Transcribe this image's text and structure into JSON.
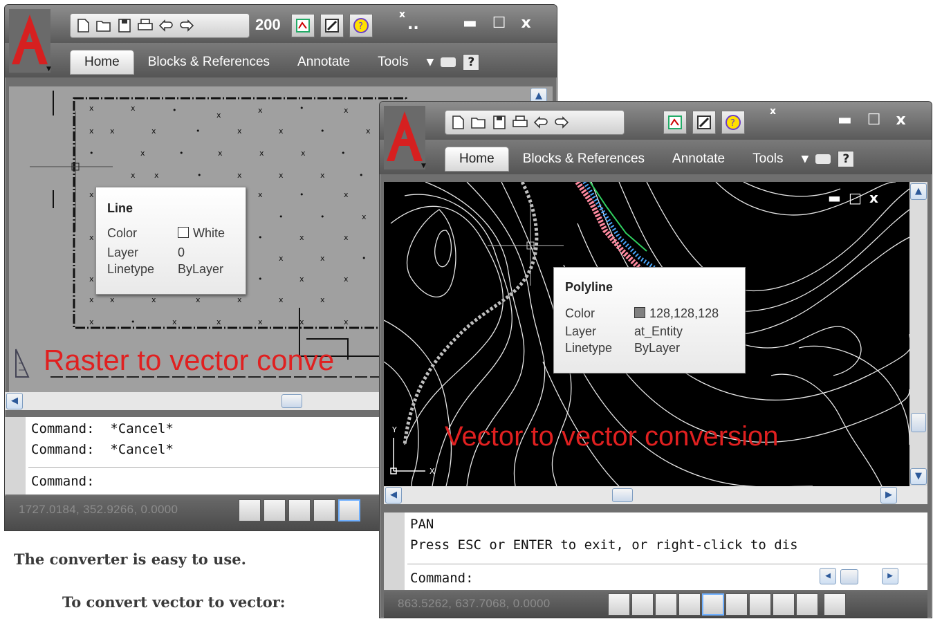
{
  "colors": {
    "accent_red": "#e02020",
    "window_gray": "#6f6f6f",
    "tooltip_bg": "#ffffff"
  },
  "window_left": {
    "qat_icons": [
      "new-icon",
      "open-icon",
      "save-icon",
      "print-icon",
      "undo-icon",
      "redo-icon"
    ],
    "toolbar_truncated": "200",
    "extra_close": "x",
    "ellipsis": "..",
    "tabs": [
      "Home",
      "Blocks & References",
      "Annotate",
      "Tools"
    ],
    "overlay_label": "Raster to vector conve",
    "tooltip": {
      "title": "Line",
      "color_label": "Color",
      "color_value": "White",
      "layer_label": "Layer",
      "layer_value": "0",
      "linetype_label": "Linetype",
      "linetype_value": "ByLayer"
    },
    "command_lines": [
      "Command:  *Cancel*",
      "Command:  *Cancel*"
    ],
    "command_prompt": "Command:",
    "coords": "1727.0184, 352.9266, 0.0000"
  },
  "window_right": {
    "extra_close": "x",
    "tabs": [
      "Home",
      "Blocks & References",
      "Annotate",
      "Tools"
    ],
    "overlay_label": "Vector to vector conversion",
    "tooltip": {
      "title": "Polyline",
      "color_label": "Color",
      "color_value": "128,128,128",
      "layer_label": "Layer",
      "layer_value": "at_Entity",
      "linetype_label": "Linetype",
      "linetype_value": "ByLayer"
    },
    "ucs_y": "Y",
    "ucs_x": "X",
    "command_lines": [
      "PAN",
      "Press ESC or ENTER to exit, or right-click to dis"
    ],
    "command_prompt": "Command:",
    "coords": "863.5262, 637.7068, 0.0000"
  },
  "document": {
    "line1": "The converter is easy to use.",
    "line2": "To convert vector to vector:"
  }
}
